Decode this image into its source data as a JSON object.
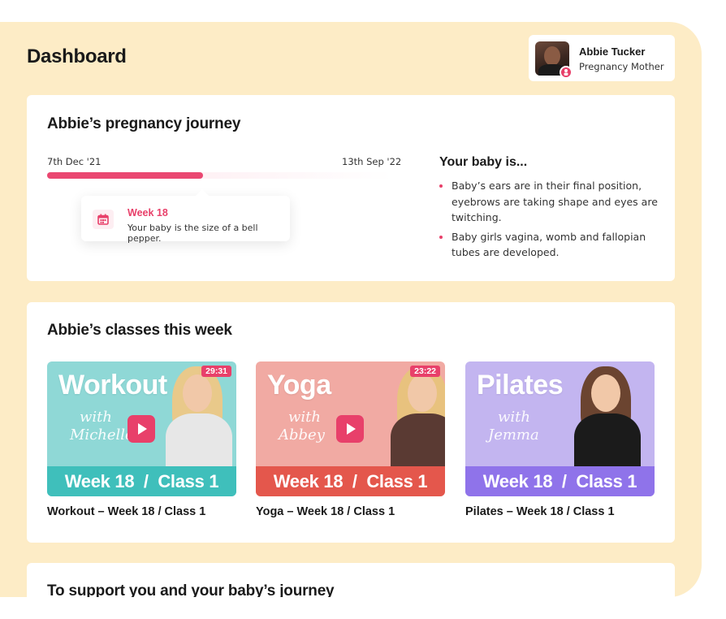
{
  "header": {
    "title": "Dashboard"
  },
  "profile": {
    "name": "Abbie Tucker",
    "role": "Pregnancy Mother"
  },
  "journey": {
    "title": "Abbie’s pregnancy journey",
    "start_date": "7th Dec '21",
    "end_date": "13th Sep '22",
    "progress_fraction": 0.45,
    "current": {
      "week": "Week 18",
      "text": "Your baby is the size of a bell pepper."
    },
    "baby_heading": "Your baby is...",
    "facts": [
      "Baby’s ears are in their final position, eyebrows are taking shape and eyes are twitching.",
      "Baby girls vagina, womb and fallopian tubes are developed."
    ]
  },
  "classes": {
    "title": "Abbie’s classes this week",
    "items": [
      {
        "thumb_title": "Workout",
        "with": "with",
        "instructor": "Michelle",
        "duration": "29:31",
        "band": "Week 18  /  Class 1",
        "label": "Workout – Week 18 / Class 1",
        "bg": "#8fd8d6",
        "band_color": "#3fbfbb",
        "has_play": true,
        "hair": "#e9c98a",
        "outfit": "#e7e7e7"
      },
      {
        "thumb_title": "Yoga",
        "with": "with",
        "instructor": "Abbey",
        "duration": "23:22",
        "band": "Week 18  /  Class 1",
        "label": "Yoga – Week 18 / Class 1",
        "bg": "#f1aaa3",
        "band_color": "#e4574c",
        "has_play": true,
        "hair": "#e8c27e",
        "outfit": "#5a3a33"
      },
      {
        "thumb_title": "Pilates",
        "with": "with",
        "instructor": "Jemma",
        "duration": "",
        "band": "Week 18  /  Class 1",
        "label": "Pilates – Week 18 / Class 1",
        "bg": "#c3b5f0",
        "band_color": "#8f73ea",
        "has_play": false,
        "hair": "#6b4430",
        "outfit": "#1b1b1b"
      }
    ]
  },
  "support": {
    "title": "To support you and your baby’s journey"
  },
  "colors": {
    "accent": "#e8406a",
    "background": "#fdecc6",
    "card": "#ffffff"
  }
}
